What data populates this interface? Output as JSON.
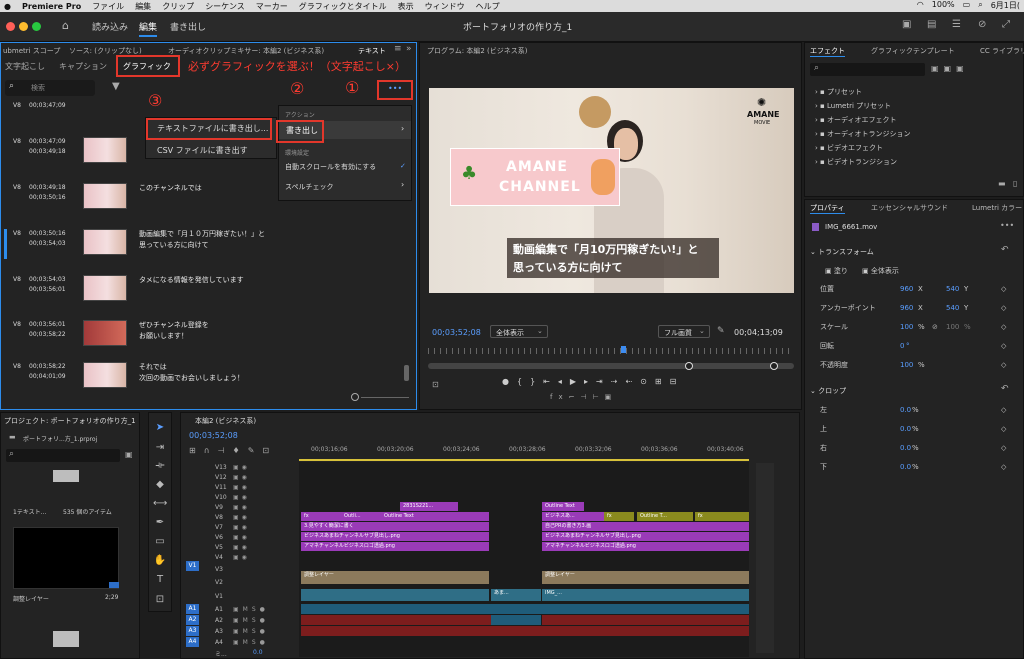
{
  "menubar": {
    "app": "Premiere Pro",
    "items": [
      "ファイル",
      "編集",
      "クリップ",
      "シーケンス",
      "マーカー",
      "グラフィックとタイトル",
      "表示",
      "ウィンドウ",
      "ヘルプ"
    ],
    "battery": "100%",
    "date": "6月1日("
  },
  "window": {
    "workspaces": [
      "読み込み",
      "編集",
      "書き出し"
    ],
    "title": "ポートフォリオの作り方_1"
  },
  "text_panel": {
    "tabs_top": [
      "ubmetri スコープ",
      "ソース: (クリップなし)",
      "オーディオクリップミキサー: 本編2 (ビジネス系)",
      "テキスト"
    ],
    "subtabs": [
      "文字起こし",
      "キャプション",
      "グラフィック"
    ],
    "search_placeholder": "検索",
    "more_button": "•••",
    "annotation_main": "必ずグラフィックを選ぶ！（文字起こし×）",
    "annotation_1": "①",
    "annotation_2": "②",
    "annotation_3": "③",
    "rows": [
      {
        "track": "V8",
        "tc1": "00;03;47;09",
        "tc2": "",
        "text1": "",
        "text2": ""
      },
      {
        "track": "V8",
        "tc1": "00;03;47;09",
        "tc2": "00;03;49;18",
        "text1": "",
        "text2": ""
      },
      {
        "track": "V8",
        "tc1": "00;03;49;18",
        "tc2": "00;03;50;16",
        "text1": "このチャンネルでは",
        "text2": ""
      },
      {
        "track": "V8",
        "tc1": "00;03;50;16",
        "tc2": "00;03;54;03",
        "text1": "動画編集で「月１０万円稼ぎたい！」と",
        "text2": "思っている方に向けて"
      },
      {
        "track": "V8",
        "tc1": "00;03;54;03",
        "tc2": "00;03;56;01",
        "text1": "タメになる情報を発信しています",
        "text2": ""
      },
      {
        "track": "V8",
        "tc1": "00;03;56;01",
        "tc2": "00;03;58;22",
        "text1": "ぜひチャンネル登録を",
        "text2": "お願いします！"
      },
      {
        "track": "V8",
        "tc1": "00;03;58;22",
        "tc2": "00;04;01;09",
        "text1": "それでは",
        "text2": "次回の動画でお会いしましょう！"
      }
    ]
  },
  "export_submenu": {
    "items": [
      "テキストファイルに書き出し...",
      "CSV ファイルに書き出す"
    ]
  },
  "action_menu": {
    "section1": "アクション",
    "export": "書き出し",
    "section2": "環境設定",
    "autoscroll": "自動スクロールを有効にする",
    "spellcheck": "スペルチェック"
  },
  "program": {
    "header": "プログラム: 本編2 (ビジネス系)",
    "tc_current": "00;03;52;08",
    "zoom": "全体表示",
    "quality": "フル画質",
    "tc_duration": "00;04;13;09",
    "video_badge_line1": "AMANE",
    "video_badge_line2": "CHANNEL",
    "video_logo": "AMANE",
    "video_logo_sub": "MOVIE",
    "caption_line1": "動画編集で「月10万円稼ぎたい!」と",
    "caption_line2": "思っている方に向けて"
  },
  "effects": {
    "tabs": [
      "エフェクト",
      "グラフィックテンプレート",
      "CC ライブラリ"
    ],
    "items": [
      "プリセット",
      "Lumetri プリセット",
      "オーディオエフェクト",
      "オーディオトランジション",
      "ビデオエフェクト",
      "ビデオトランジション"
    ]
  },
  "properties": {
    "tabs": [
      "プロパティ",
      "エッセンシャルサウンド",
      "Lumetri カラー"
    ],
    "clip": "IMG_6661.mov",
    "transform": "トランスフォーム",
    "fill": "塗り",
    "fit": "全体表示",
    "rows": [
      {
        "label": "位置",
        "v1": "960",
        "u1": "X",
        "v2": "540",
        "u2": "Y"
      },
      {
        "label": "アンカーポイント",
        "v1": "960",
        "u1": "X",
        "v2": "540",
        "u2": "Y"
      },
      {
        "label": "スケール",
        "v1": "100",
        "u1": "%",
        "v2": "100",
        "u2": "%"
      },
      {
        "label": "回転",
        "v1": "0",
        "u1": "°",
        "v2": "",
        "u2": ""
      },
      {
        "label": "不透明度",
        "v1": "100",
        "u1": "%",
        "v2": "",
        "u2": ""
      }
    ],
    "crop": "クロップ",
    "crop_rows": [
      {
        "label": "左",
        "v": "0.0",
        "u": "%"
      },
      {
        "label": "上",
        "v": "0.0",
        "u": "%"
      },
      {
        "label": "右",
        "v": "0.0",
        "u": "%"
      },
      {
        "label": "下",
        "v": "0.0",
        "u": "%"
      }
    ]
  },
  "project": {
    "header": "プロジェクト: ポートフォリオの作り方_1",
    "file": "ポートフォリ...方_1.prproj",
    "bin_label": "1テキスト...",
    "count": "535 個のアイテム",
    "item_name": "調整レイヤー",
    "item_dur": "2;29"
  },
  "timeline": {
    "header": "本編2 (ビジネス系)",
    "tc": "00;03;52;08",
    "ruler": [
      "00;03;16;06",
      "00;03;20;06",
      "00;03;24;06",
      "00;03;28;06",
      "00;03;32;06",
      "00;03;36;06",
      "00;03;40;06"
    ],
    "video_tracks": [
      "V13",
      "V12",
      "V11",
      "V10",
      "V9",
      "V8",
      "V7",
      "V6",
      "V5",
      "V4",
      "V3",
      "V2",
      "V1"
    ],
    "audio_tracks": [
      "A1",
      "A2",
      "A3",
      "A4"
    ],
    "mix": "ミ...",
    "mix_val": "0.0",
    "clips": {
      "v9a": "2831S221...",
      "v9b": "Outline Text",
      "v8a": "Outli...",
      "v8b": "Outline Text",
      "v8c": "ビジネスあ...",
      "v8d": "Outline T...",
      "v7a": "3.見やすく簡潔に書く",
      "v7b": "自己PRの書き方3.画",
      "v6a": "ビジネスあまねチャンネルサブ見出し.png",
      "v6b": "ビジネスあまねチャンネルサブ見出し.png",
      "v5a": "アマネチャンネルビジネスロゴ透過.png",
      "v5b": "アマネチャンネルビジネスロゴ透過.png",
      "v2a": "調整レイヤー",
      "v2b": "調整レイヤー",
      "v1a": "あま...",
      "v1b": "IMG_..."
    }
  }
}
